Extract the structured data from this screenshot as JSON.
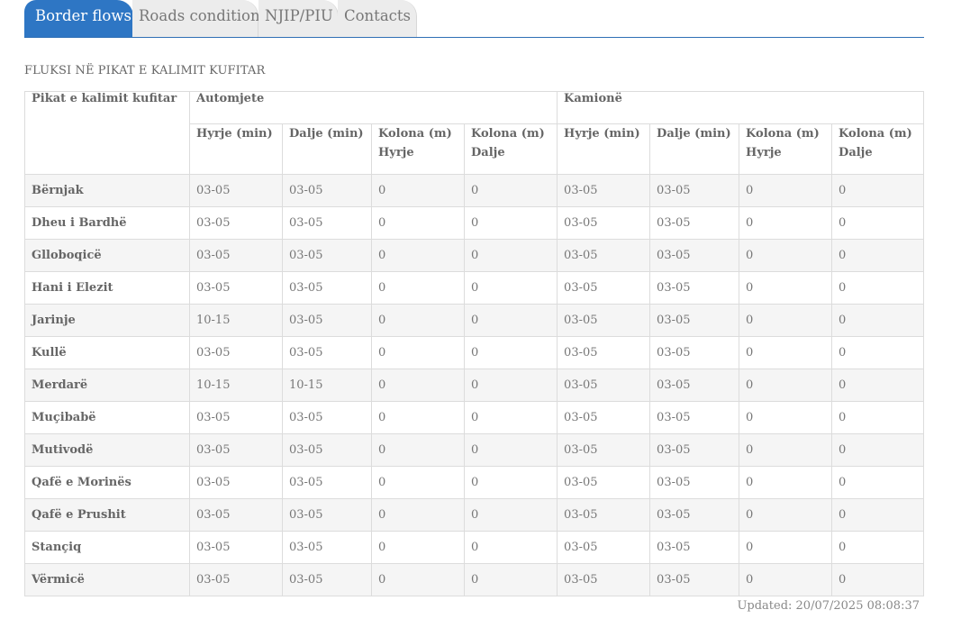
{
  "tabs": [
    {
      "label": "Border flows",
      "active": true
    },
    {
      "label": "Roads condition",
      "active": false
    },
    {
      "label": "NJIP/PIU",
      "active": false
    },
    {
      "label": "Contacts",
      "active": false
    }
  ],
  "section_title": "FLUKSI NË PIKAT E KALIMIT KUFITAR",
  "table": {
    "corner_header": "Pikat e kalimit kufitar",
    "groups": [
      "Automjete",
      "Kamionë"
    ],
    "subheaders": {
      "cars": {
        "entry": "Hyrje (min)",
        "exit": "Dalje (min)",
        "queue_entry_1": "Kolona (m)",
        "queue_entry_2": "Hyrje",
        "queue_exit_1": "Kolona (m)",
        "queue_exit_2": "Dalje"
      },
      "trucks": {
        "entry": "Hyrje (min)",
        "exit": "Dalje (min)",
        "queue_entry_1": "Kolona (m)",
        "queue_entry_2": "Hyrje",
        "queue_exit_1": "Kolona (m)",
        "queue_exit_2": "Dalje"
      }
    },
    "rows": [
      {
        "name": "Bërnjak",
        "c": [
          "03-05",
          "03-05",
          "0",
          "0",
          "03-05",
          "03-05",
          "0",
          "0"
        ]
      },
      {
        "name": "Dheu i Bardhë",
        "c": [
          "03-05",
          "03-05",
          "0",
          "0",
          "03-05",
          "03-05",
          "0",
          "0"
        ]
      },
      {
        "name": "Glloboqicë",
        "c": [
          "03-05",
          "03-05",
          "0",
          "0",
          "03-05",
          "03-05",
          "0",
          "0"
        ]
      },
      {
        "name": "Hani i Elezit",
        "c": [
          "03-05",
          "03-05",
          "0",
          "0",
          "03-05",
          "03-05",
          "0",
          "0"
        ]
      },
      {
        "name": "Jarinje",
        "c": [
          "10-15",
          "03-05",
          "0",
          "0",
          "03-05",
          "03-05",
          "0",
          "0"
        ]
      },
      {
        "name": "Kullë",
        "c": [
          "03-05",
          "03-05",
          "0",
          "0",
          "03-05",
          "03-05",
          "0",
          "0"
        ]
      },
      {
        "name": "Merdarë",
        "c": [
          "10-15",
          "10-15",
          "0",
          "0",
          "03-05",
          "03-05",
          "0",
          "0"
        ]
      },
      {
        "name": "Muçibabë",
        "c": [
          "03-05",
          "03-05",
          "0",
          "0",
          "03-05",
          "03-05",
          "0",
          "0"
        ]
      },
      {
        "name": "Mutivodë",
        "c": [
          "03-05",
          "03-05",
          "0",
          "0",
          "03-05",
          "03-05",
          "0",
          "0"
        ]
      },
      {
        "name": "Qafë e Morinës",
        "c": [
          "03-05",
          "03-05",
          "0",
          "0",
          "03-05",
          "03-05",
          "0",
          "0"
        ]
      },
      {
        "name": "Qafë e Prushit",
        "c": [
          "03-05",
          "03-05",
          "0",
          "0",
          "03-05",
          "03-05",
          "0",
          "0"
        ]
      },
      {
        "name": "Stançiq",
        "c": [
          "03-05",
          "03-05",
          "0",
          "0",
          "03-05",
          "03-05",
          "0",
          "0"
        ]
      },
      {
        "name": "Vërmicë",
        "c": [
          "03-05",
          "03-05",
          "0",
          "0",
          "03-05",
          "03-05",
          "0",
          "0"
        ]
      }
    ]
  },
  "updated": "Updated: 20/07/2025 08:08:37",
  "colors": {
    "accent": "#2e76c4",
    "row_alt": "#f5f5f5",
    "border": "#dcdcdc"
  }
}
